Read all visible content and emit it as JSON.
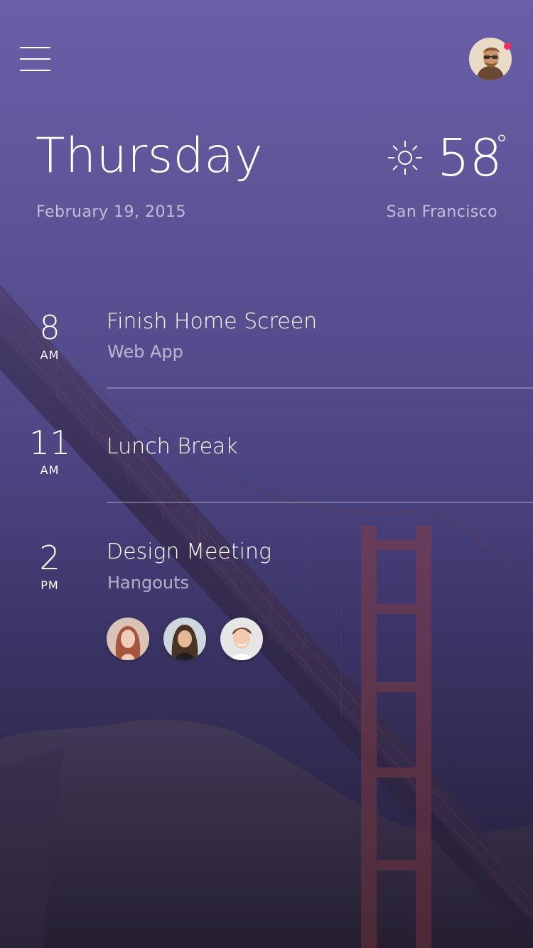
{
  "header": {
    "menu_icon": "hamburger-menu-icon",
    "profile_icon": "user-avatar",
    "notification_color": "#ff2a5a"
  },
  "today": {
    "day": "Thursday",
    "date": "February 19, 2015"
  },
  "weather": {
    "icon": "sun-icon",
    "temperature": "58",
    "degree_symbol": "°",
    "city": "San Francisco"
  },
  "events": [
    {
      "hour": "8",
      "ampm": "AM",
      "title": "Finish Home Screen",
      "subtitle": "Web App"
    },
    {
      "hour": "11",
      "ampm": "AM",
      "title": "Lunch Break",
      "subtitle": ""
    },
    {
      "hour": "2",
      "ampm": "PM",
      "title": "Design Meeting",
      "subtitle": "Hangouts"
    }
  ],
  "attendees": [
    {
      "icon": "attendee-avatar-1"
    },
    {
      "icon": "attendee-avatar-2"
    },
    {
      "icon": "attendee-avatar-3"
    }
  ],
  "theme": {
    "background_top": "#6a5fa8",
    "background_bottom": "#1f1c33",
    "bridge_color": "#8a3a3a"
  }
}
